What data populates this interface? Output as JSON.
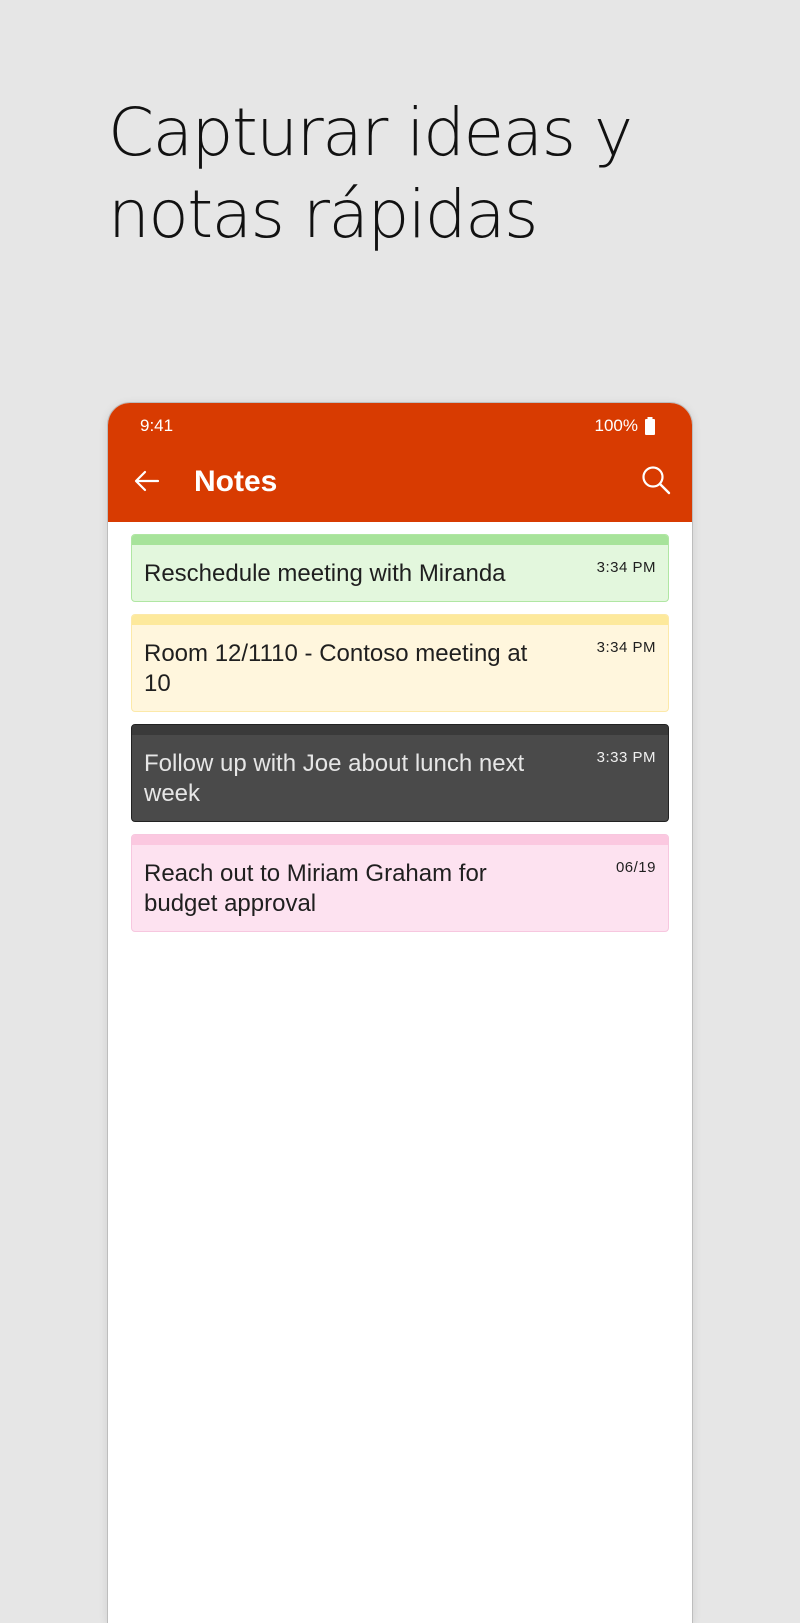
{
  "headline": {
    "line1": "Capturar ideas y",
    "line2": "notas rápidas"
  },
  "status_bar": {
    "time": "9:41",
    "battery": "100%",
    "battery_icon": "battery-full-icon"
  },
  "app_bar": {
    "back_icon": "arrow-left-icon",
    "title": "Notes",
    "search_icon": "search-icon",
    "color": "#d83b01"
  },
  "notes": [
    {
      "text": "Reschedule meeting with Miranda",
      "time": "3:34 PM",
      "color": "green"
    },
    {
      "text": "Room 12/1110 - Contoso meeting at 10",
      "time": "3:34 PM",
      "color": "yellow"
    },
    {
      "text": "Follow up with Joe about lunch next week",
      "time": "3:33 PM",
      "color": "charcoal"
    },
    {
      "text": "Reach out to Miriam Graham for budget approval",
      "time": "06/19",
      "color": "pink"
    }
  ]
}
